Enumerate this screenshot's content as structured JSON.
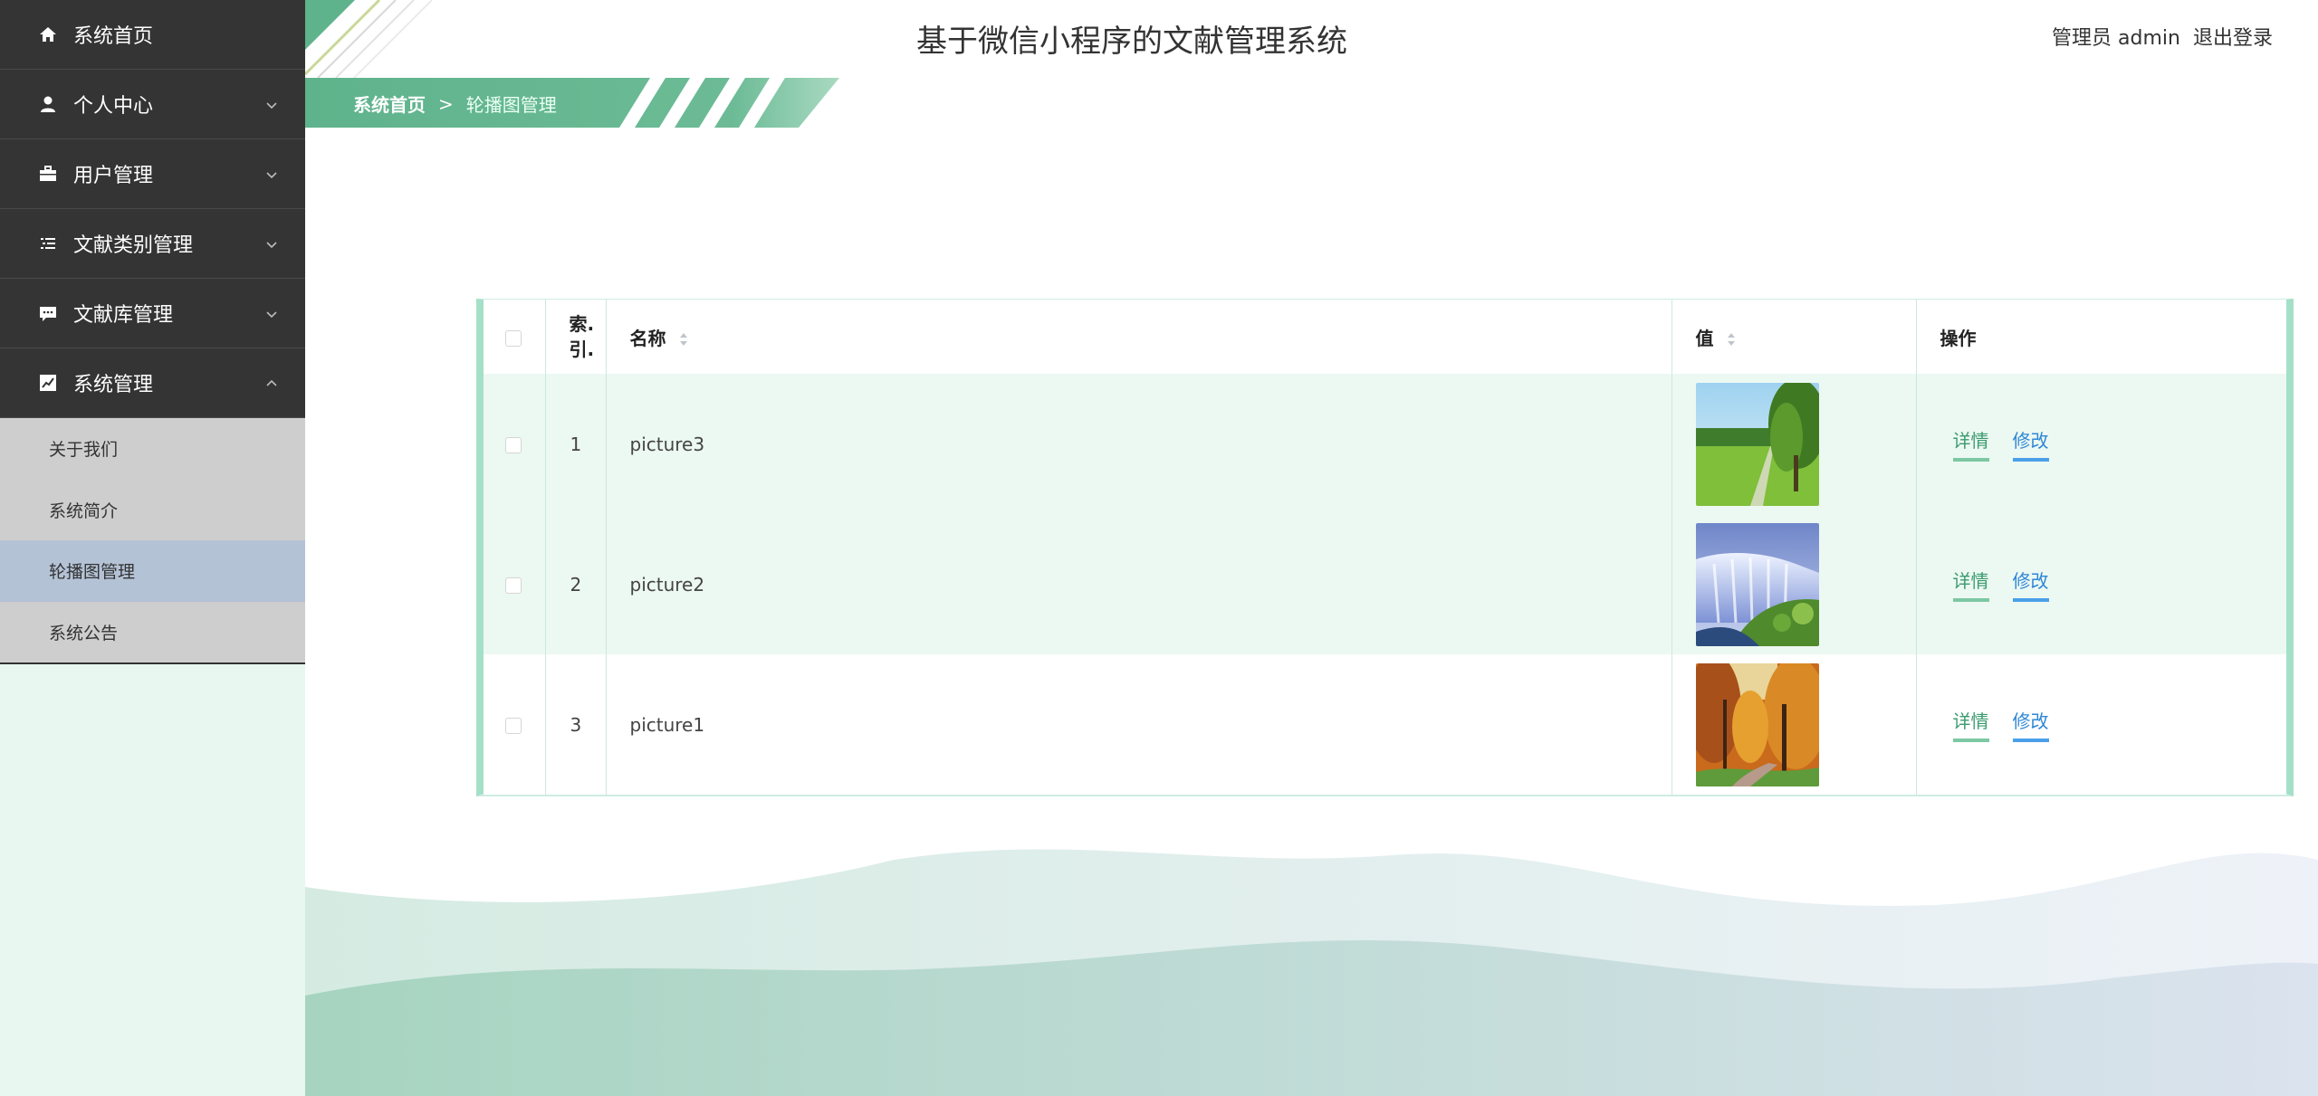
{
  "app": {
    "title": "基于微信小程序的文献管理系统"
  },
  "user": {
    "label": "管理员 admin",
    "logout": "退出登录"
  },
  "sidebar": {
    "items": [
      {
        "label": "系统首页",
        "icon": "home-icon"
      },
      {
        "label": "个人中心",
        "icon": "user-icon"
      },
      {
        "label": "用户管理",
        "icon": "briefcase-icon"
      },
      {
        "label": "文献类别管理",
        "icon": "list-icon"
      },
      {
        "label": "文献库管理",
        "icon": "chat-icon"
      },
      {
        "label": "系统管理",
        "icon": "chart-icon"
      }
    ],
    "submenu": [
      {
        "label": "关于我们"
      },
      {
        "label": "系统简介"
      },
      {
        "label": "轮播图管理"
      },
      {
        "label": "系统公告"
      }
    ]
  },
  "breadcrumb": {
    "home": "系统首页",
    "separator": ">",
    "current": "轮播图管理"
  },
  "table": {
    "headers": {
      "index_line1": "索.",
      "index_line2": "引.",
      "name": "名称",
      "value": "值",
      "actions": "操作"
    },
    "rows": [
      {
        "index": "1",
        "name": "picture3",
        "image": "green-field-path"
      },
      {
        "index": "2",
        "name": "picture2",
        "image": "waterfall"
      },
      {
        "index": "3",
        "name": "picture1",
        "image": "autumn-forest"
      }
    ],
    "action_labels": {
      "detail": "详情",
      "edit": "修改"
    }
  },
  "colors": {
    "sidebar_bg": "#343434",
    "submenu_bg": "#cecece",
    "submenu_active": "#b4c2d6",
    "accent_green": "#5fb38c",
    "link_blue": "#2f87d6"
  }
}
